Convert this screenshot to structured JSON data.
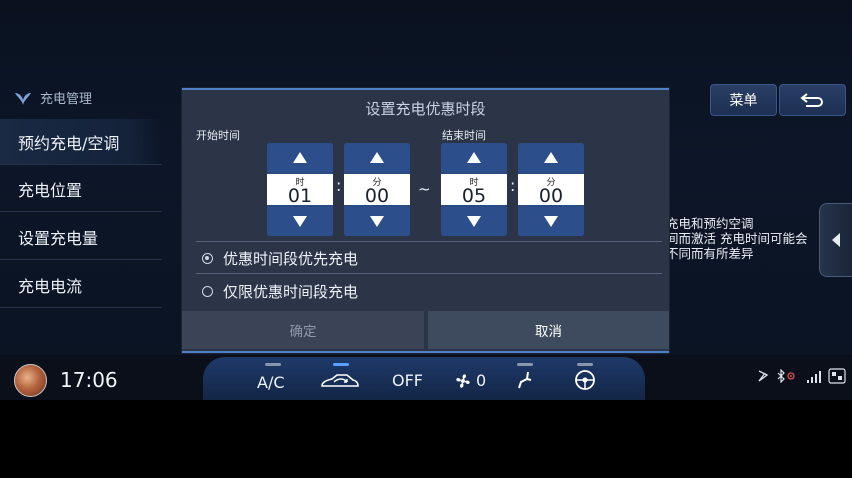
{
  "sidebar": {
    "header": "充电管理",
    "items": [
      {
        "label": "预约充电/空调"
      },
      {
        "label": "充电位置"
      },
      {
        "label": "设置充电量"
      },
      {
        "label": "充电电流"
      }
    ]
  },
  "top_buttons": {
    "menu_label": "菜单"
  },
  "info_text": [
    "充电和预约空调",
    "间而激活 充电时间可能会",
    "不同而有所差异"
  ],
  "dialog": {
    "title": "设置充电优惠时段",
    "start_label": "开始时间",
    "end_label": "结束时间",
    "start_hour": {
      "unit": "时",
      "value": "01"
    },
    "start_min": {
      "unit": "分",
      "value": "00"
    },
    "end_hour": {
      "unit": "时",
      "value": "05"
    },
    "end_min": {
      "unit": "分",
      "value": "00"
    },
    "separator": ":",
    "range_separator": "~",
    "options": [
      {
        "label": "优惠时间段优先充电",
        "selected": true
      },
      {
        "label": "仅限优惠时间段充电",
        "selected": false
      }
    ],
    "confirm_label": "确定",
    "cancel_label": "取消"
  },
  "status_bar": {
    "time": "17:06",
    "ac_label": "A/C",
    "off_label": "OFF",
    "fan_level": "0"
  },
  "colors": {
    "accent": "#4f7fc6",
    "spinner": "#2c4f8c",
    "dialog_bg": "#2b3547"
  }
}
